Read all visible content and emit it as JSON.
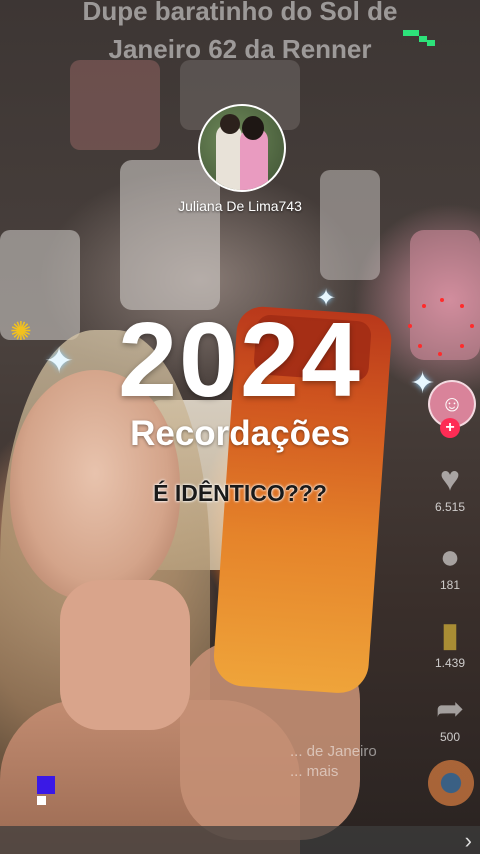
{
  "video": {
    "overlay_title_line1": "Dupe baratinho do Sol de",
    "overlay_title_line2": "Janeiro 62 da Renner",
    "template_username": "Juliana De Lima743",
    "year": "2024",
    "recordacoes": "Recordações",
    "caption_overlay": "É IDÊNTICO???"
  },
  "rail": {
    "creator_icon": "smiley-icon",
    "follow_icon": "plus-icon",
    "like_count": "6.515",
    "comment_count": "181",
    "save_count": "1.439",
    "share_count": "500"
  },
  "caption": {
    "line1": "... de Janeiro",
    "line2": "... mais"
  },
  "colors": {
    "accent_red": "#fe2c55",
    "title_text": "#ebebeb"
  }
}
